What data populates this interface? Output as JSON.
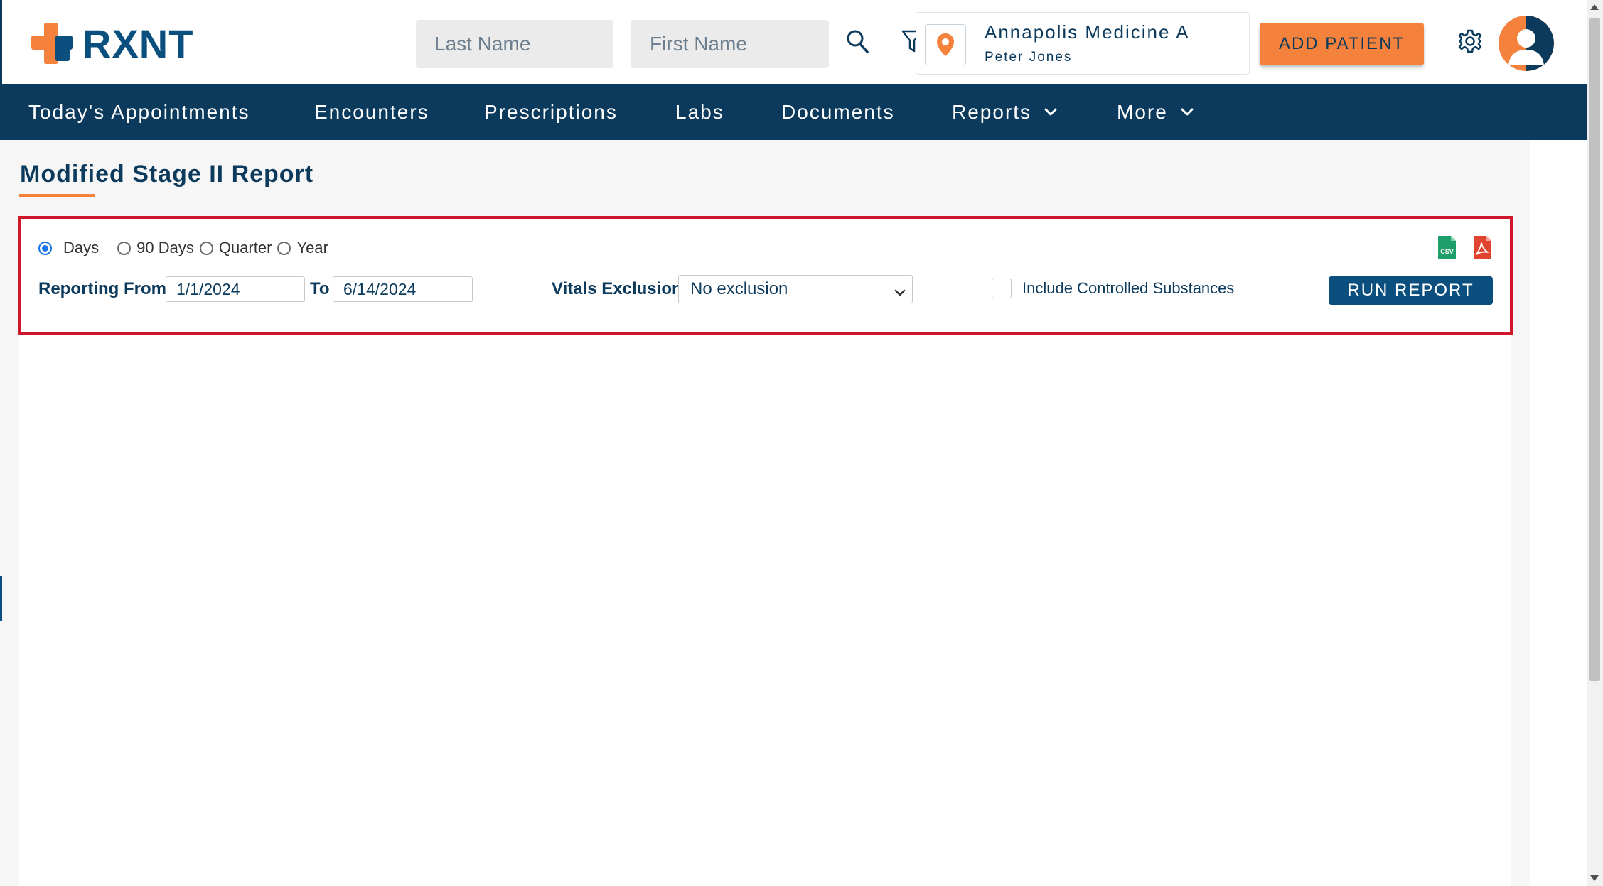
{
  "header": {
    "logo_text": "RXNT",
    "last_name_placeholder": "Last Name",
    "first_name_placeholder": "First Name",
    "location": {
      "name": "Annapolis Medicine A",
      "user": "Peter Jones"
    },
    "add_patient_label": "ADD PATIENT"
  },
  "nav": {
    "items": [
      {
        "label": "Today's Appointments"
      },
      {
        "label": "Encounters"
      },
      {
        "label": "Prescriptions"
      },
      {
        "label": "Labs"
      },
      {
        "label": "Documents"
      },
      {
        "label": "Reports",
        "has_dropdown": true
      },
      {
        "label": "More",
        "has_dropdown": true
      }
    ]
  },
  "page": {
    "title": "Modified Stage II Report"
  },
  "filters": {
    "period_options": [
      {
        "label": "Days",
        "selected": true
      },
      {
        "label": "90 Days",
        "selected": false
      },
      {
        "label": "Quarter",
        "selected": false
      },
      {
        "label": "Year",
        "selected": false
      }
    ],
    "reporting_from_label": "Reporting From",
    "from_date": "1/1/2024",
    "to_label": "To",
    "to_date": "6/14/2024",
    "vitals_exclusion_label": "Vitals Exclusion",
    "vitals_exclusion_value": "No exclusion",
    "include_controlled_label": "Include Controlled Substances",
    "include_controlled_checked": false,
    "run_report_label": "RUN REPORT",
    "export_icons": [
      "csv-icon",
      "pdf-icon"
    ],
    "csv_icon_text": "CSV"
  },
  "colors": {
    "brand_navy": "#0b3a5c",
    "brand_blue": "#0b4f7f",
    "brand_orange": "#f4813c",
    "highlight_red": "#d0162a",
    "csv_green": "#1e9e6a",
    "pdf_red": "#e0442f"
  }
}
